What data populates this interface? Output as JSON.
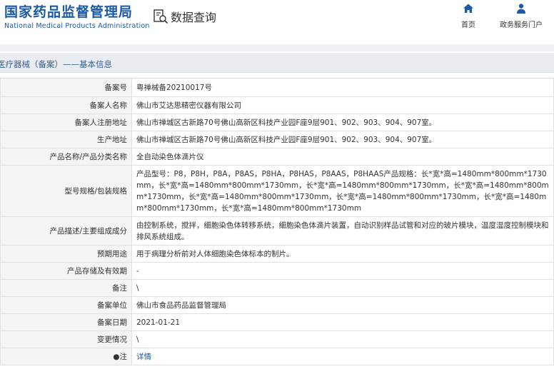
{
  "header": {
    "logo_cn": "国家药品监督管理局",
    "logo_en": "National Medical Products Administration",
    "query_label": "数据查询",
    "nav": [
      {
        "label": "首页",
        "icon": "home-icon"
      },
      {
        "label": "政务服务门户",
        "icon": "user-icon"
      }
    ]
  },
  "breadcrumb": "医疗器械（备案）——基本信息",
  "colors": {
    "brand_blue": "#1a5aa6",
    "label_bg": "#f4f4f4",
    "border": "#e0e0e0"
  },
  "rows": [
    {
      "label": "备案号",
      "value": "粤禅械备20210017号"
    },
    {
      "label": "备案人名称",
      "value": "佛山市艾达思精密仪器有限公司"
    },
    {
      "label": "备案人注册地址",
      "value": "佛山市禅城区古新路70号佛山高新区科技产业园F座9层901、902、903、904、907室。"
    },
    {
      "label": "生产地址",
      "value": "佛山市禅城区古新路70号佛山高新区科技产业园F座9层901、902、903、904、907室。"
    },
    {
      "label": "产品名称/产品分类名称",
      "value": "全自动染色体滴片仪"
    },
    {
      "label": "型号规格/包装规格",
      "value": "产品型号：P8，P8H，P8A，P8AS，P8HA，P8HAS，P8AAS，P8HAAS产品规格：长*宽*高=1480mm*800mm*1730mm，长*宽*高=1480mm*800mm*1730mm，长*宽*高=1480mm*800mm*1730mm，长*宽*高=1480mm*800mm*1730mm，长*宽*高=1480mm*800mm*1730mm，长*宽*高=1480mm*800mm*1730mm，长*宽*高=1480mm*800mm*1730mm，长*宽*高=1480mm*800mm*1730mm"
    },
    {
      "label": "产品描述/主要组成成分",
      "value": "由控制系统，搅拌，细胞染色体转移系统，细胞染色体滴片装置，自动识别样品试管和对应的玻片模块，温度湿度控制模块和排风系统组成。"
    },
    {
      "label": "预期用途",
      "value": "用于病理分析前对人体细胞染色体标本的制片。"
    },
    {
      "label": "产品存储及有效期",
      "value": "-"
    },
    {
      "label": "备注",
      "value": "\\"
    },
    {
      "label": "备案单位",
      "value": "佛山市食品药品监督管理局"
    },
    {
      "label": "备案日期",
      "value": "2021-01-21"
    },
    {
      "label": "变更情况",
      "value": "\\"
    },
    {
      "label": "●注",
      "value": "详情"
    }
  ]
}
